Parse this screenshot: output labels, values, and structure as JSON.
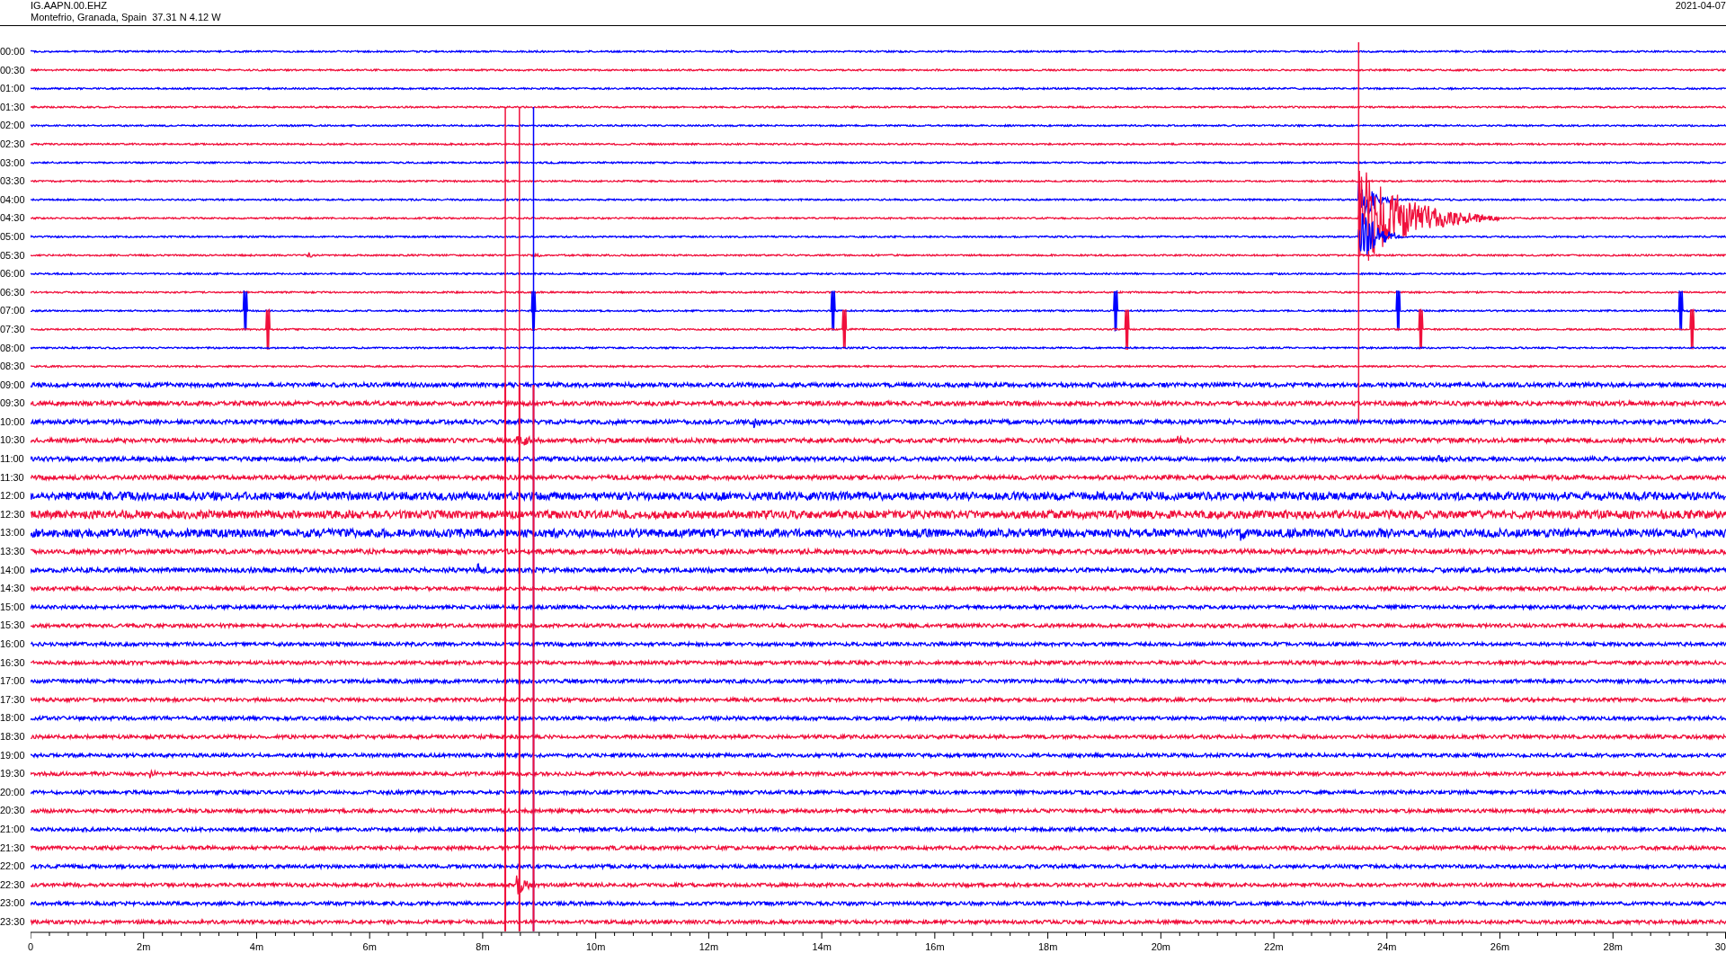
{
  "header": {
    "station": "IG.AAPN.00.EHZ",
    "location": "Montefrio, Granada, Spain  37.31 N 4.12 W",
    "date": "2021-04-07"
  },
  "rows": [
    {
      "time": "00:00",
      "color": "#0000ff"
    },
    {
      "time": "00:30",
      "color": "#f0103c"
    },
    {
      "time": "01:00",
      "color": "#0000ff"
    },
    {
      "time": "01:30",
      "color": "#f0103c"
    },
    {
      "time": "02:00",
      "color": "#0000ff"
    },
    {
      "time": "02:30",
      "color": "#f0103c"
    },
    {
      "time": "03:00",
      "color": "#0000ff"
    },
    {
      "time": "03:30",
      "color": "#f0103c"
    },
    {
      "time": "04:00",
      "color": "#0000ff"
    },
    {
      "time": "04:30",
      "color": "#f0103c"
    },
    {
      "time": "05:00",
      "color": "#0000ff"
    },
    {
      "time": "05:30",
      "color": "#f0103c"
    },
    {
      "time": "06:00",
      "color": "#0000ff"
    },
    {
      "time": "06:30",
      "color": "#f0103c"
    },
    {
      "time": "07:00",
      "color": "#0000ff"
    },
    {
      "time": "07:30",
      "color": "#f0103c"
    },
    {
      "time": "08:00",
      "color": "#0000ff"
    },
    {
      "time": "08:30",
      "color": "#f0103c"
    },
    {
      "time": "09:00",
      "color": "#0000ff"
    },
    {
      "time": "09:30",
      "color": "#f0103c"
    },
    {
      "time": "10:00",
      "color": "#0000ff"
    },
    {
      "time": "10:30",
      "color": "#f0103c"
    },
    {
      "time": "11:00",
      "color": "#0000ff"
    },
    {
      "time": "11:30",
      "color": "#f0103c"
    },
    {
      "time": "12:00",
      "color": "#0000ff"
    },
    {
      "time": "12:30",
      "color": "#f0103c"
    },
    {
      "time": "13:00",
      "color": "#0000ff"
    },
    {
      "time": "13:30",
      "color": "#f0103c"
    },
    {
      "time": "14:00",
      "color": "#0000ff"
    },
    {
      "time": "14:30",
      "color": "#f0103c"
    },
    {
      "time": "15:00",
      "color": "#0000ff"
    },
    {
      "time": "15:30",
      "color": "#f0103c"
    },
    {
      "time": "16:00",
      "color": "#0000ff"
    },
    {
      "time": "16:30",
      "color": "#f0103c"
    },
    {
      "time": "17:00",
      "color": "#0000ff"
    },
    {
      "time": "17:30",
      "color": "#f0103c"
    },
    {
      "time": "18:00",
      "color": "#0000ff"
    },
    {
      "time": "18:30",
      "color": "#f0103c"
    },
    {
      "time": "19:00",
      "color": "#0000ff"
    },
    {
      "time": "19:30",
      "color": "#f0103c"
    },
    {
      "time": "20:00",
      "color": "#0000ff"
    },
    {
      "time": "20:30",
      "color": "#f0103c"
    },
    {
      "time": "21:00",
      "color": "#0000ff"
    },
    {
      "time": "21:30",
      "color": "#f0103c"
    },
    {
      "time": "22:00",
      "color": "#0000ff"
    },
    {
      "time": "22:30",
      "color": "#f0103c"
    },
    {
      "time": "23:00",
      "color": "#0000ff"
    },
    {
      "time": "23:30",
      "color": "#f0103c"
    }
  ],
  "x_axis": {
    "ticks": [
      "0",
      "2m",
      "4m",
      "6m",
      "8m",
      "10m",
      "12m",
      "14m",
      "16m",
      "18m",
      "20m",
      "22m",
      "24m",
      "26m",
      "28m",
      "30"
    ]
  }
}
